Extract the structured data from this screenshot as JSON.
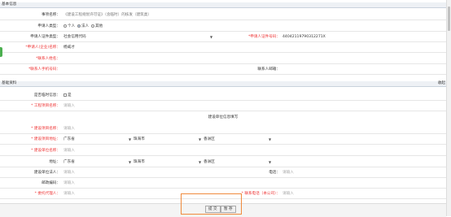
{
  "sections": {
    "basic_info": "基本信息",
    "basic_data": "基础资料",
    "side_action": "收起"
  },
  "form1": {
    "item_name_label": "事项名称：",
    "item_name_value": "《建设工程规划许可证》（含临时）的核发（建筑类）",
    "applicant_type_label": "申请人类型：",
    "applicant_type_opt1": "个人",
    "applicant_type_opt2": "法人",
    "applicant_type_opt3": "其他",
    "cert_type_label": "申请人证件类型：",
    "cert_type_value": "社会信用代码",
    "cert_no_label": "*申请人证件号码：",
    "cert_no_value": "44042119790312271X",
    "applicant_name_label": "*申请人(企业)名称：",
    "applicant_name_value": "杨威才",
    "contact_name_label": "*联系人姓名：",
    "contact_phone_label": "*联系人手机号码：",
    "contact_email_label": "联系人邮箱："
  },
  "form2": {
    "is_temp_label": "是否临时信息：",
    "is_temp_opt": "是",
    "project_name_label": "* 工程项目名称：",
    "project_name_placeholder": "请输入",
    "builder_section_title": "建设单位信息填写",
    "builder_name_label": "* 建设项目名称：",
    "builder_name_placeholder": "请输入",
    "builder_addr_label": "* 建设项目地址：",
    "province": "广东省",
    "city": "珠海市",
    "district": "香洲区",
    "unit_name_label": "* 建设单位名称：",
    "unit_name_placeholder": "请输入",
    "location_label": "地址：",
    "loc_province": "广东省",
    "loc_city": "珠海市",
    "loc_district": "香洲区",
    "legal_person_label": "建设单位法人：",
    "legal_person_placeholder": "请输入",
    "phone_label": "电话：",
    "phone_placeholder": "请输入",
    "postcode_label": "邮政编码：",
    "postcode_placeholder": "请输入",
    "agent_label": "* 委托代理人：",
    "agent_placeholder": "请输入",
    "contact_label": "* 联系电话（本公司）：",
    "contact_placeholder": "请输入"
  },
  "footer": {
    "save_label": "暂 存",
    "submit_label": "提 交"
  }
}
